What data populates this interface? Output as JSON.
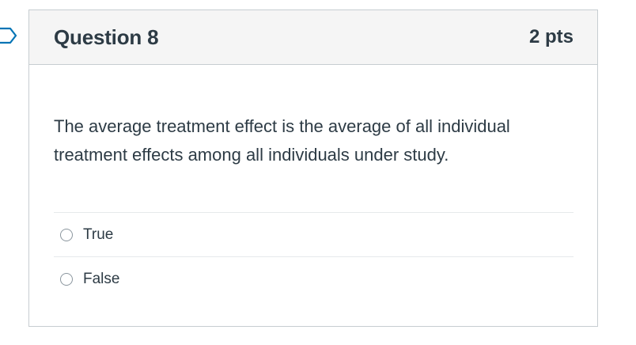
{
  "question": {
    "title": "Question 8",
    "points": "2 pts",
    "text": "The average treatment effect is the average of all individual treatment effects among all individuals under study.",
    "answers": [
      {
        "label": "True",
        "selected": false
      },
      {
        "label": "False",
        "selected": false
      }
    ]
  },
  "flag": {
    "icon": "bookmark-flag-icon",
    "color": "#0374b5"
  },
  "colors": {
    "header_bg": "#f5f5f5",
    "border": "#c7cdd1",
    "text": "#2d3b45"
  }
}
